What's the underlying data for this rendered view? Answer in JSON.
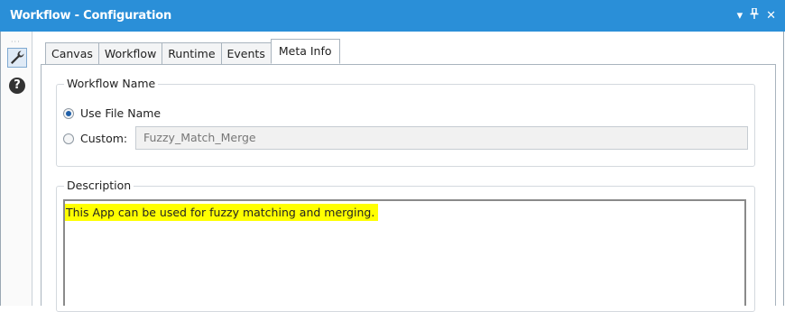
{
  "window": {
    "title": "Workflow - Configuration",
    "controls": [
      "▾",
      "⊥",
      "✕"
    ]
  },
  "sidebar": {
    "grip": "···",
    "help_glyph": "?"
  },
  "tabs": [
    {
      "label": "Canvas"
    },
    {
      "label": "Workflow"
    },
    {
      "label": "Runtime"
    },
    {
      "label": "Events"
    },
    {
      "label": "Meta Info",
      "active": true
    }
  ],
  "workflow_name": {
    "group_label": "Workflow Name",
    "option_file": "Use File Name",
    "option_custom": "Custom:",
    "custom_value": "Fuzzy_Match_Merge"
  },
  "description": {
    "group_label": "Description",
    "text": "This App can be used for fuzzy matching and merging."
  },
  "colors": {
    "titlebar": "#2a8fd8",
    "highlight": "#ffff00"
  }
}
